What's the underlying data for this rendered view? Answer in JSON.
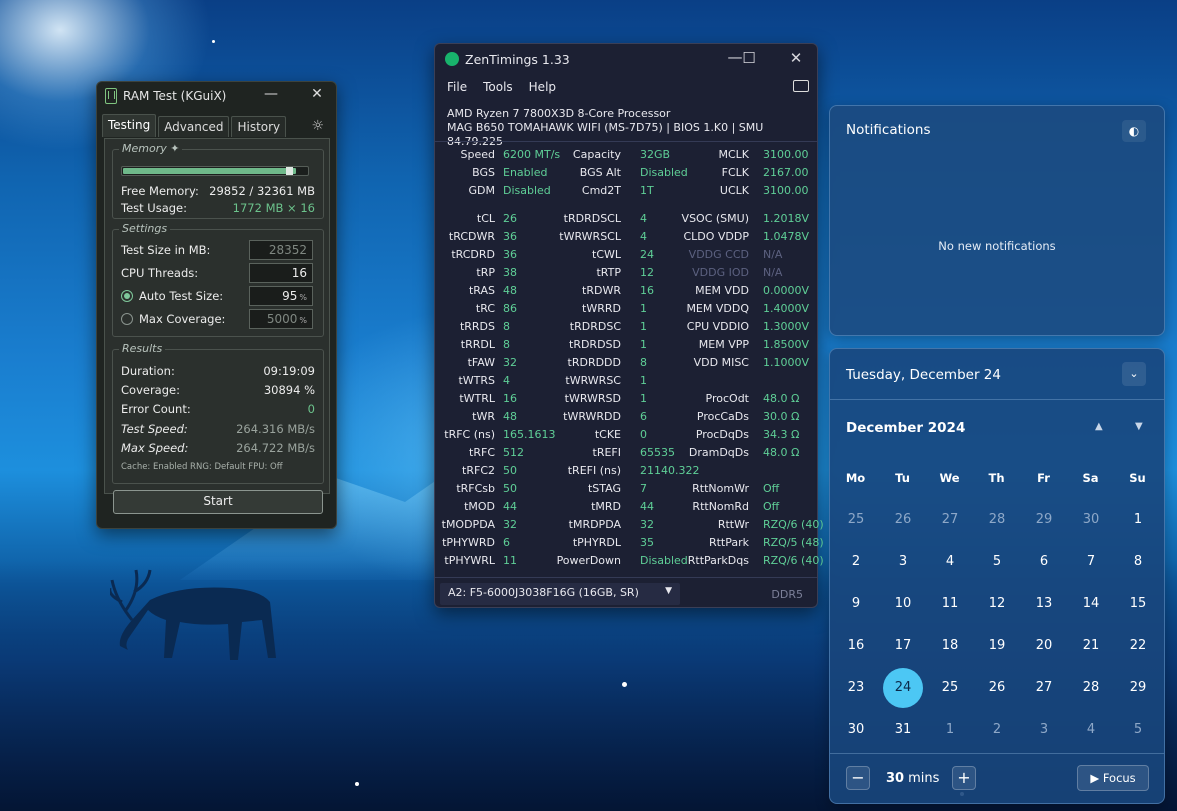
{
  "ramtest": {
    "title": "RAM Test (KGuiX)",
    "minimize": "—",
    "close": "✕",
    "tabs": [
      "Testing",
      "Advanced",
      "History"
    ],
    "memory": {
      "label": "Memory",
      "usage_fraction": 0.94,
      "free_label": "Free Memory:",
      "free_value": "29852 / 32361 MB",
      "test_usage_label": "Test Usage:",
      "test_usage_value": "1772 MB × 16"
    },
    "settings": {
      "label": "Settings",
      "test_size_label": "Test Size in MB:",
      "test_size_value": "28352",
      "cpu_threads_label": "CPU Threads:",
      "cpu_threads_value": "16",
      "auto_test_label": "Auto Test Size:",
      "auto_test_value": "95",
      "max_coverage_label": "Max Coverage:",
      "max_coverage_value": "5000",
      "percent": "%"
    },
    "results": {
      "label": "Results",
      "duration_label": "Duration:",
      "duration_value": "09:19:09",
      "coverage_label": "Coverage:",
      "coverage_value": "30894 %",
      "errors_label": "Error Count:",
      "errors_value": "0",
      "test_speed_label": "Test Speed:",
      "test_speed_value": "264.316 MB/s",
      "max_speed_label": "Max Speed:",
      "max_speed_value": "264.722 MB/s",
      "footer": "Cache: Enabled  RNG: Default  FPU: Off"
    },
    "start_label": "Start"
  },
  "zen": {
    "title": "ZenTimings 1.33",
    "menu": [
      "File",
      "Tools",
      "Help"
    ],
    "cpu": "AMD Ryzen 7 7800X3D 8-Core Processor",
    "board": "MAG B650 TOMAHAWK WIFI (MS-7D75) | BIOS 1.K0 | SMU 84.79.225",
    "top_rows": [
      [
        "Speed",
        "6200 MT/s",
        "Capacity",
        "32GB",
        "MCLK",
        "3100.00"
      ],
      [
        "BGS",
        "Enabled",
        "BGS Alt",
        "Disabled",
        "FCLK",
        "2167.00"
      ],
      [
        "GDM",
        "Disabled",
        "Cmd2T",
        "1T",
        "UCLK",
        "3100.00"
      ]
    ],
    "rows": [
      [
        "tCL",
        "26",
        "tRDRDSCL",
        "4",
        "VSOC (SMU)",
        "1.2018V"
      ],
      [
        "tRCDWR",
        "36",
        "tWRWRSCL",
        "4",
        "CLDO VDDP",
        "1.0478V"
      ],
      [
        "tRCDRD",
        "36",
        "tCWL",
        "24",
        "VDDG CCD",
        "N/A"
      ],
      [
        "tRP",
        "38",
        "tRTP",
        "12",
        "VDDG IOD",
        "N/A"
      ],
      [
        "tRAS",
        "48",
        "tRDWR",
        "16",
        "MEM VDD",
        "0.0000V"
      ],
      [
        "tRC",
        "86",
        "tWRRD",
        "1",
        "MEM VDDQ",
        "1.4000V"
      ],
      [
        "tRRDS",
        "8",
        "tRDRDSC",
        "1",
        "CPU VDDIO",
        "1.3000V"
      ],
      [
        "tRRDL",
        "8",
        "tRDRDSD",
        "1",
        "MEM VPP",
        "1.8500V"
      ],
      [
        "tFAW",
        "32",
        "tRDRDDD",
        "8",
        "VDD MISC",
        "1.1000V"
      ],
      [
        "tWTRS",
        "4",
        "tWRWRSC",
        "1",
        "",
        ""
      ],
      [
        "tWTRL",
        "16",
        "tWRWRSD",
        "1",
        "ProcOdt",
        "48.0 Ω"
      ],
      [
        "tWR",
        "48",
        "tWRWRDD",
        "6",
        "ProcCaDs",
        "30.0 Ω"
      ],
      [
        "tRFC (ns)",
        "165.1613",
        "tCKE",
        "0",
        "ProcDqDs",
        "34.3 Ω"
      ],
      [
        "tRFC",
        "512",
        "tREFI",
        "65535",
        "DramDqDs",
        "48.0 Ω"
      ],
      [
        "tRFC2",
        "50",
        "tREFI (ns)",
        "21140.322",
        "",
        ""
      ],
      [
        "tRFCsb",
        "50",
        "tSTAG",
        "7",
        "RttNomWr",
        "Off"
      ],
      [
        "tMOD",
        "44",
        "tMRD",
        "44",
        "RttNomRd",
        "Off"
      ],
      [
        "tMODPDA",
        "32",
        "tMRDPDA",
        "32",
        "RttWr",
        "RZQ/6 (40)"
      ],
      [
        "tPHYWRD",
        "6",
        "tPHYRDL",
        "35",
        "RttPark",
        "RZQ/5 (48)"
      ],
      [
        "tPHYWRL",
        "11",
        "PowerDown",
        "Disabled",
        "RttParkDqs",
        "RZQ/6 (40)"
      ]
    ],
    "dim_labels": [
      "VDDG CCD",
      "VDDG IOD"
    ],
    "module": "A2: F5-6000J3038F16G (16GB, SR)",
    "ddr": "DDR5"
  },
  "notifications": {
    "title": "Notifications",
    "empty": "No new notifications"
  },
  "calendar": {
    "date_header": "Tuesday, December 24",
    "month": "December 2024",
    "weekdays": [
      "Mo",
      "Tu",
      "We",
      "Th",
      "Fr",
      "Sa",
      "Su"
    ],
    "weeks": [
      [
        "25",
        "26",
        "27",
        "28",
        "29",
        "30",
        "1"
      ],
      [
        "2",
        "3",
        "4",
        "5",
        "6",
        "7",
        "8"
      ],
      [
        "9",
        "10",
        "11",
        "12",
        "13",
        "14",
        "15"
      ],
      [
        "16",
        "17",
        "18",
        "19",
        "20",
        "21",
        "22"
      ],
      [
        "23",
        "24",
        "25",
        "26",
        "27",
        "28",
        "29"
      ],
      [
        "30",
        "31",
        "1",
        "2",
        "3",
        "4",
        "5"
      ]
    ],
    "today": "24",
    "focus_minutes": "30",
    "focus_unit": "mins",
    "focus_label": "Focus",
    "minus": "−",
    "plus": "+"
  },
  "colors": {
    "accent": "#4cc7f4",
    "zen_value": "#5fcf97",
    "ramtest_green": "#6cc38c"
  }
}
